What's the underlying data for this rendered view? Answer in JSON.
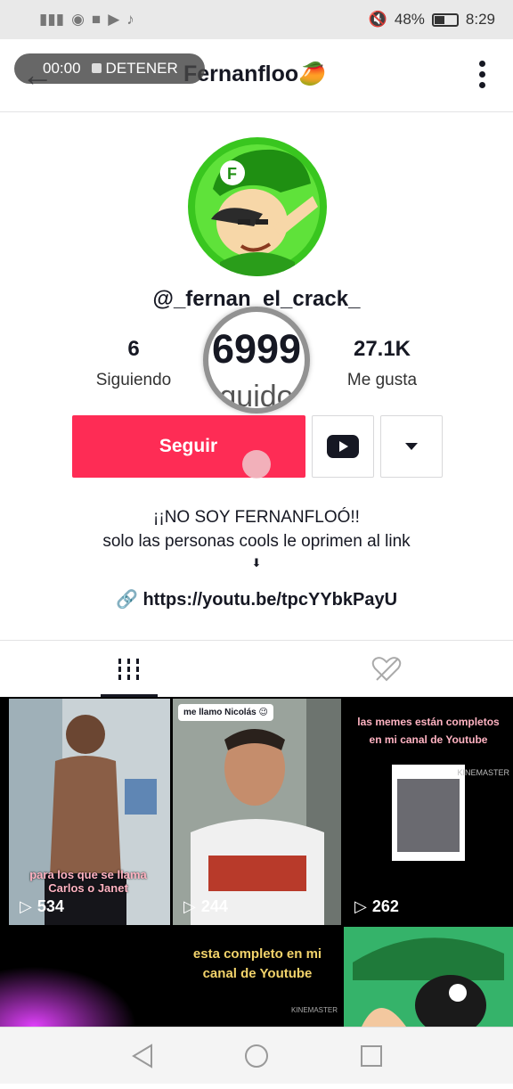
{
  "status_bar": {
    "battery": "48%",
    "time": "8:29",
    "battery_level": 0.48
  },
  "recording": {
    "timer": "00:00",
    "stop_label": "DETENER"
  },
  "header": {
    "title": "Fernanfloo",
    "title_emoji": "🥭"
  },
  "profile": {
    "username": "@_fernan_el_crack_",
    "following_count": "6",
    "following_label": "Siguiendo",
    "followers_count": "6999",
    "followers_label_fragment": "guido",
    "likes_count": "27.1K",
    "likes_label": "Me gusta"
  },
  "actions": {
    "follow_label": "Seguir"
  },
  "bio": {
    "line1": "¡¡NO SOY FERNANFLOÓ!!",
    "line2": "solo las personas cools le oprimen al link",
    "arrow": "⬇",
    "link": "https://youtu.be/tpcYYbkPayU"
  },
  "videos": [
    {
      "views": "534",
      "caption": "para los que se llama Carlos o Janet"
    },
    {
      "views": "244",
      "reply_label": "me llamo Nicolás 😉"
    },
    {
      "views": "262",
      "caption": "las memes están completos en mi canal de Youtube",
      "watermark": "KINEMASTER"
    },
    {
      "views": "",
      "caption": ""
    },
    {
      "views": "",
      "caption": "esta completo en mi canal de Youtube",
      "watermark": "KINEMASTER"
    },
    {
      "views": "",
      "caption": ""
    }
  ],
  "colors": {
    "accent": "#fe2c55",
    "text": "#161823",
    "avatar_bg": "#39c61f"
  }
}
